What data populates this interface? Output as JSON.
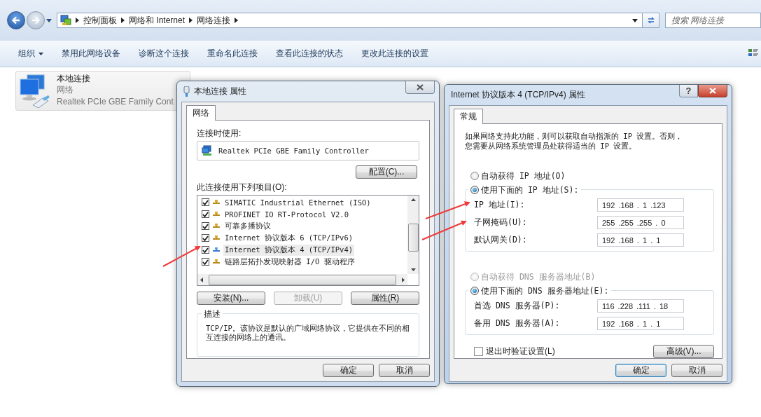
{
  "explorer": {
    "breadcrumbs": [
      "控制面板",
      "网络和 Internet",
      "网络连接"
    ],
    "search": {
      "placeholder": "搜索 网络连接"
    },
    "toolbar": [
      {
        "label": "组织",
        "kind": "menu"
      },
      {
        "label": "禁用此网络设备",
        "kind": "command"
      },
      {
        "label": "诊断这个连接",
        "kind": "command"
      },
      {
        "label": "重命名此连接",
        "kind": "command"
      },
      {
        "label": "查看此连接的状态",
        "kind": "command"
      },
      {
        "label": "更改此连接的设置",
        "kind": "command"
      }
    ],
    "connection": {
      "name": "本地连接",
      "network": "网络",
      "adapter": "Realtek PCIe GBE Family Cont"
    }
  },
  "properties_dialog": {
    "title": "本地连接 属性",
    "tabs": [
      {
        "label": "网络",
        "selected": true
      }
    ],
    "connect_using_label": "连接时使用:",
    "adapter": "Realtek PCIe GBE Family Controller",
    "configure_button": "配置(C)...",
    "items_label": "此连接使用下列项目(O):",
    "items": [
      {
        "label": "SIMATIC Industrial Ethernet (ISO)",
        "checked": true,
        "selected": false
      },
      {
        "label": "PROFINET IO RT-Protocol V2.0",
        "checked": true,
        "selected": false
      },
      {
        "label": "可靠多播协议",
        "checked": true,
        "selected": false
      },
      {
        "label": "Internet 协议版本 6 (TCP/IPv6)",
        "checked": true,
        "selected": false
      },
      {
        "label": "Internet 协议版本 4 (TCP/IPv4)",
        "checked": true,
        "selected": true
      },
      {
        "label": "链路层拓扑发现映射器 I/O 驱动程序",
        "checked": true,
        "selected": false
      }
    ],
    "item_buttons": [
      {
        "label": "安装(N)...",
        "disabled": false
      },
      {
        "label": "卸载(U)",
        "disabled": true
      },
      {
        "label": "属性(R)",
        "disabled": false
      }
    ],
    "description_label": "描述",
    "description": "TCP/IP。该协议是默认的广域网络协议，它提供在不同的相互连接的网络上的通讯。",
    "buttons": [
      {
        "label": "确定",
        "default": false
      },
      {
        "label": "取消",
        "default": false
      }
    ]
  },
  "ipv4_dialog": {
    "title": "Internet 协议版本 4 (TCP/IPv4) 属性",
    "help_button": "?",
    "tabs": [
      {
        "label": "常规",
        "selected": true
      }
    ],
    "intro": "如果网络支持此功能，则可以获取自动指派的 IP 设置。否则，您需要从网络系统管理员处获得适当的 IP 设置。",
    "ip_mode": [
      {
        "label": "自动获得 IP 地址(O)",
        "selected": false,
        "disabled": false
      },
      {
        "label": "使用下面的 IP 地址(S):",
        "selected": true,
        "disabled": false
      }
    ],
    "ip_fields": [
      {
        "label": "IP 地址(I):",
        "value": "192 .168 . 1 .123"
      },
      {
        "label": "子网掩码(U):",
        "value": "255 .255 .255 . 0"
      },
      {
        "label": "默认网关(D):",
        "value": "192 .168 . 1 . 1"
      }
    ],
    "dns_mode": [
      {
        "label": "自动获得 DNS 服务器地址(B)",
        "selected": false,
        "disabled": true
      },
      {
        "label": "使用下面的 DNS 服务器地址(E):",
        "selected": true,
        "disabled": false
      }
    ],
    "dns_fields": [
      {
        "label": "首选 DNS 服务器(P):",
        "value": "116 .228 .111 . 18"
      },
      {
        "label": "备用 DNS 服务器(A):",
        "value": "192 .168 . 1 . 1"
      }
    ],
    "validate_checkbox": {
      "label": "退出时验证设置(L)",
      "checked": false
    },
    "advanced_button": "高级(V)...",
    "buttons": [
      {
        "label": "确定",
        "default": true
      },
      {
        "label": "取消",
        "default": false
      }
    ]
  }
}
